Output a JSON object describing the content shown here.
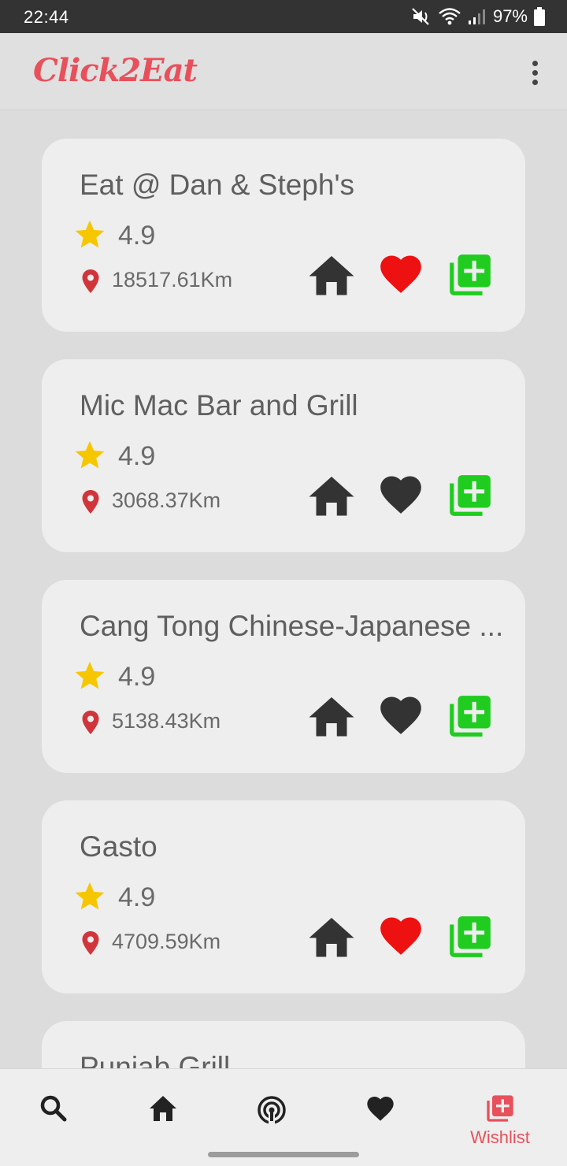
{
  "status_bar": {
    "time": "22:44",
    "battery": "97%"
  },
  "app_bar": {
    "title": "Click2Eat",
    "menu_icon": "more-vert-icon"
  },
  "restaurants": [
    {
      "name": "Eat @ Dan & Steph's",
      "rating": "4.9",
      "distance": "18517.61Km",
      "favorited": true
    },
    {
      "name": "Mic Mac Bar and Grill",
      "rating": "4.9",
      "distance": "3068.37Km",
      "favorited": false
    },
    {
      "name": "Cang Tong Chinese-Japanese ...",
      "rating": "4.9",
      "distance": "5138.43Km",
      "favorited": false
    },
    {
      "name": "Gasto",
      "rating": "4.9",
      "distance": "4709.59Km",
      "favorited": true
    },
    {
      "name": "Punjab Grill",
      "rating": "",
      "distance": "",
      "favorited": false
    }
  ],
  "bottom_nav": {
    "items": [
      {
        "id": "search",
        "icon": "search-icon",
        "label": ""
      },
      {
        "id": "home",
        "icon": "home-icon",
        "label": ""
      },
      {
        "id": "nearby",
        "icon": "broadcast-icon",
        "label": ""
      },
      {
        "id": "favorites",
        "icon": "heart-icon",
        "label": ""
      },
      {
        "id": "wishlist",
        "icon": "add-to-list-icon",
        "label": "Wishlist",
        "active": true
      }
    ]
  },
  "colors": {
    "brand": "#e8505b",
    "star": "#f6c700",
    "pin": "#d0353b",
    "heart_active": "#ee1111",
    "heart_inactive": "#333333",
    "add_green": "#1fcc1f",
    "icon_dark": "#333333"
  }
}
